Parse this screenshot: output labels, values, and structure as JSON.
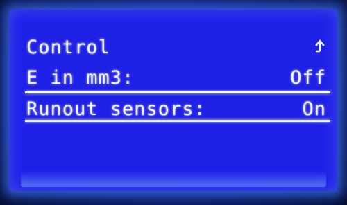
{
  "menu": {
    "title": "Control",
    "items": [
      {
        "label": "E in mm3:",
        "value": "Off"
      },
      {
        "label": "Runout sensors:",
        "value": "On"
      }
    ]
  },
  "icons": {
    "back": "up-arrow-icon"
  },
  "colors": {
    "screen_background": "#1f20e6",
    "text": "#f3f5ff",
    "backlight_glow": "#3c78ff"
  }
}
